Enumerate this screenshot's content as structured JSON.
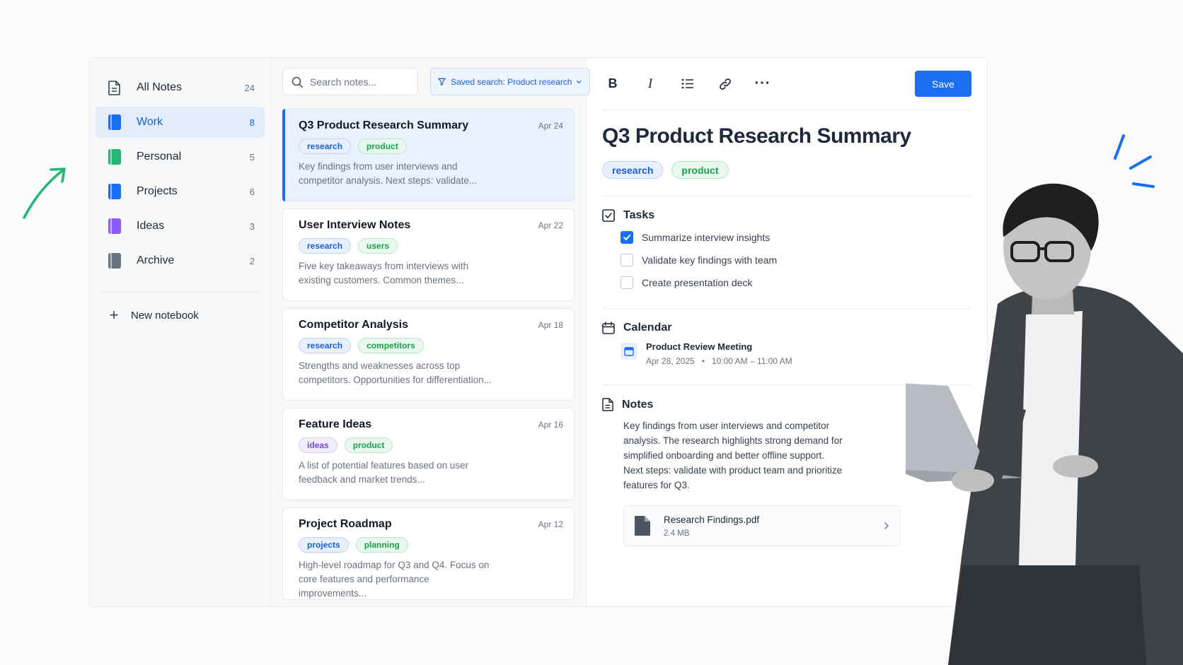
{
  "sidebar": {
    "items": [
      {
        "label": "All Notes",
        "count": "24"
      },
      {
        "label": "Work",
        "count": "8"
      },
      {
        "label": "Personal",
        "count": "5"
      },
      {
        "label": "Projects",
        "count": "6"
      },
      {
        "label": "Ideas",
        "count": "3"
      },
      {
        "label": "Archive",
        "count": "2"
      }
    ],
    "new_notebook": "New notebook"
  },
  "colors": {
    "accent": "#1a6ef0",
    "work": "#1a6ef0",
    "personal": "#22b573",
    "projects": "#1a6ef0",
    "ideas": "#8b5cf6",
    "archive": "#6b7280"
  },
  "list": {
    "search_placeholder": "Search notes...",
    "saved_search": "Saved search: Product research",
    "notes": [
      {
        "title": "Q3 Product Research Summary",
        "date": "Apr 24",
        "tags": [
          "research",
          "product"
        ],
        "snippet": "Key findings from user interviews and competitor analysis. Next steps: validate..."
      },
      {
        "title": "User Interview Notes",
        "date": "Apr 22",
        "tags": [
          "research",
          "users"
        ],
        "snippet": "Five key takeaways from interviews with existing customers. Common themes..."
      },
      {
        "title": "Competitor Analysis",
        "date": "Apr 18",
        "tags": [
          "research",
          "competitors"
        ],
        "snippet": "Strengths and weaknesses across top competitors. Opportunities for differentiation..."
      },
      {
        "title": "Feature Ideas",
        "date": "Apr 16",
        "tags": [
          "ideas",
          "product"
        ],
        "snippet": "A list of potential features based on user feedback and market trends..."
      },
      {
        "title": "Project Roadmap",
        "date": "Apr 12",
        "tags": [
          "projects",
          "planning"
        ],
        "snippet": "High-level roadmap for Q3 and Q4. Focus on core features and performance improvements..."
      }
    ]
  },
  "editor": {
    "toolbar": {
      "bold": "B",
      "italic": "I",
      "more": "···",
      "save_label": "Save"
    },
    "title": "Q3 Product Research Summary",
    "tags": [
      "research",
      "product"
    ],
    "tasks_heading": "Tasks",
    "tasks": [
      {
        "label": "Summarize interview insights",
        "checked": true
      },
      {
        "label": "Validate key findings with team",
        "checked": false
      },
      {
        "label": "Create presentation deck",
        "checked": false
      }
    ],
    "calendar_heading": "Calendar",
    "event": {
      "title": "Product Review Meeting",
      "date": "Apr 28, 2025",
      "separator": "•",
      "time": "10:00 AM – 11:00 AM"
    },
    "notes_heading": "Notes",
    "notes_text": "Key findings from user interviews and competitor analysis. The research highlights strong demand for simplified onboarding and better offline support. Next steps: validate with product team and prioritize features for Q3.",
    "attachment": {
      "name": "Research Findings.pdf",
      "size": "2.4 MB"
    }
  }
}
